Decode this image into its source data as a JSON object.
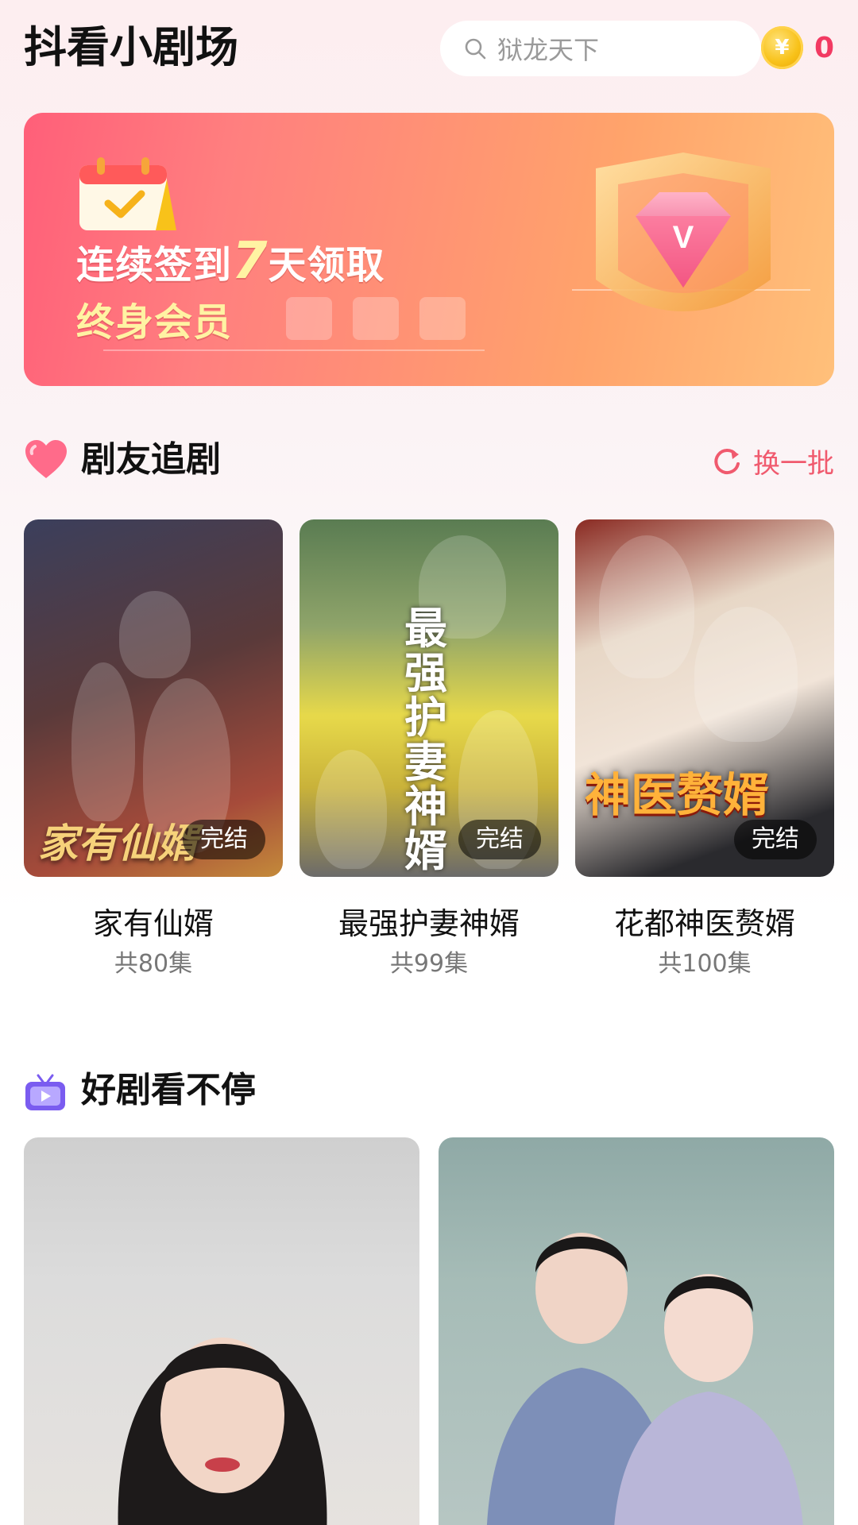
{
  "header": {
    "app_title": "抖看小剧场",
    "search_placeholder": "狱龙天下",
    "coin_count": "0",
    "coin_symbol": "¥"
  },
  "banner": {
    "line1_prefix": "连续签到",
    "line1_number": "7",
    "line1_suffix": "天领取",
    "line2": "终身会员"
  },
  "section_follow": {
    "title": "剧友追剧",
    "refresh_label": "换一批",
    "dramas": [
      {
        "name": "家有仙婿",
        "episodes": "共80集",
        "status": "完结",
        "cover_text": "家有仙婿"
      },
      {
        "name": "最强护妻神婿",
        "episodes": "共99集",
        "status": "完结",
        "cover_text": "最强护妻神婿"
      },
      {
        "name": "花都神医赘婿",
        "episodes": "共100集",
        "status": "完结",
        "cover_text": "神医赘婿"
      }
    ]
  },
  "section_feed": {
    "title": "好剧看不停"
  },
  "colors": {
    "accent": "#f05a6e",
    "coin_text": "#f23a62",
    "banner_start": "#ff5f79",
    "banner_end": "#ffc07a"
  }
}
